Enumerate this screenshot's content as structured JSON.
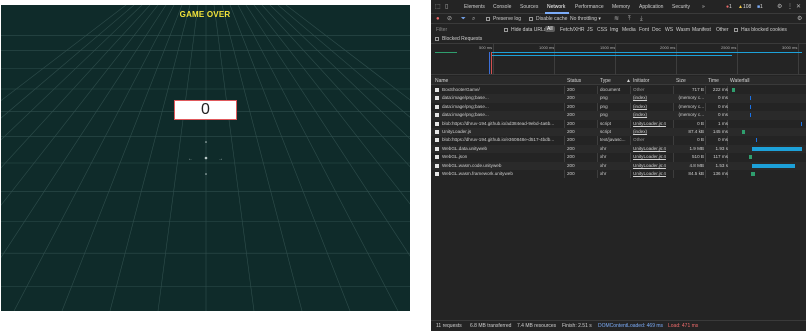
{
  "game": {
    "title": "GAME OVER",
    "score": "0",
    "colors": {
      "background": "#0f2b2a",
      "grid": "#3b5654",
      "title": "#f2e33a",
      "score_border": "#e0595c"
    }
  },
  "devtools": {
    "tabs": [
      "Elements",
      "Console",
      "Sources",
      "Network",
      "Performance",
      "Memory",
      "Application",
      "Security",
      "»"
    ],
    "active_tab": "Network",
    "badges": {
      "errors": "1",
      "warnings": "108",
      "info": "1"
    },
    "toolbar": {
      "preserve_log": "Preserve log",
      "disable_cache": "Disable cache",
      "throttling": "No throttling"
    },
    "filter": {
      "placeholder": "Filter",
      "hide_data_urls": "Hide data URLs",
      "all": "All",
      "types": [
        "Fetch/XHR",
        "JS",
        "CSS",
        "Img",
        "Media",
        "Font",
        "Doc",
        "WS",
        "Wasm",
        "Manifest",
        "Other"
      ],
      "has_blocked_cookies": "Has blocked cookies",
      "blocked_requests": "Blocked Requests"
    },
    "timeline": [
      "500 ms",
      "1000 ms",
      "1500 ms",
      "2000 ms",
      "2500 ms",
      "3000 ms"
    ],
    "columns": {
      "name": "Name",
      "status": "Status",
      "type": "Type",
      "initiator": "Initiator",
      "size": "Size",
      "time": "Time",
      "waterfall": "Waterfall"
    },
    "requests": [
      {
        "name": "BoxShooterGame/",
        "status": "200",
        "type": "document",
        "initiator": "Other",
        "size": "717 B",
        "time": "222 ms",
        "wf_start": 0.03,
        "wf_len": 0.04,
        "wf_color": "#2f9e6e"
      },
      {
        "name": "data:image/png;base...",
        "status": "200",
        "type": "png",
        "initiator": "(index)",
        "size": "(memory c...",
        "time": "0 ms",
        "wf_start": 0.28,
        "wf_len": 0.01,
        "wf_color": "#1a73e8"
      },
      {
        "name": "data:image/png;base...",
        "status": "200",
        "type": "png",
        "initiator": "(index)",
        "size": "(memory c...",
        "time": "0 ms",
        "wf_start": 0.28,
        "wf_len": 0.01,
        "wf_color": "#1a73e8"
      },
      {
        "name": "data:image/png;base...",
        "status": "200",
        "type": "png",
        "initiator": "(index)",
        "size": "(memory c...",
        "time": "0 ms",
        "wf_start": 0.28,
        "wf_len": 0.01,
        "wf_color": "#1a73e8"
      },
      {
        "name": "blob:https://dhruv-194.github.io/ad384ead-9ebd-4a6b...",
        "status": "200",
        "type": "script",
        "initiator": "UnityLoader.js:4",
        "size": "0 B",
        "time": "1 ms",
        "wf_start": 0.99,
        "wf_len": 0.01,
        "wf_color": "#1a73e8"
      },
      {
        "name": "UnityLoader.js",
        "status": "200",
        "type": "script",
        "initiator": "(index)",
        "size": "87.4 kB",
        "time": "145 ms",
        "wf_start": 0.17,
        "wf_len": 0.04,
        "wf_color": "#2f9e6e"
      },
      {
        "name": "blob:https://dhruv-194.github.io/e360848e-d517-4bdb...",
        "status": "200",
        "type": "text/javasc...",
        "initiator": "Other",
        "size": "0 B",
        "time": "0 ms",
        "wf_start": 0.36,
        "wf_len": 0.01,
        "wf_color": "#1a73e8"
      },
      {
        "name": "WebGL.data.unityweb",
        "status": "200",
        "type": "xhr",
        "initiator": "UnityLoader.js:4",
        "size": "1.9 MB",
        "time": "1.93 s",
        "wf_start": 0.3,
        "wf_len": 0.7,
        "wf_color": "#1da1d9"
      },
      {
        "name": "WebGL.json",
        "status": "200",
        "type": "xhr",
        "initiator": "UnityLoader.js:4",
        "size": "510 B",
        "time": "117 ms",
        "wf_start": 0.26,
        "wf_len": 0.05,
        "wf_color": "#2f9e6e"
      },
      {
        "name": "WebGL.wasm.code.unityweb",
        "status": "200",
        "type": "xhr",
        "initiator": "UnityLoader.js:4",
        "size": "4.8 MB",
        "time": "1.53 s",
        "wf_start": 0.3,
        "wf_len": 0.6,
        "wf_color": "#1da1d9"
      },
      {
        "name": "WebGL.wasm.framework.unityweb",
        "status": "200",
        "type": "xhr",
        "initiator": "UnityLoader.js:4",
        "size": "84.5 kB",
        "time": "136 ms",
        "wf_start": 0.29,
        "wf_len": 0.06,
        "wf_color": "#2f9e6e"
      }
    ],
    "status": {
      "requests": "11 requests",
      "transferred": "6.8 MB transferred",
      "resources": "7.4 MB resources",
      "finish": "Finish: 2.51 s",
      "dcl": "DOMContentLoaded: 469 ms",
      "load": "Load: 471 ms"
    }
  }
}
